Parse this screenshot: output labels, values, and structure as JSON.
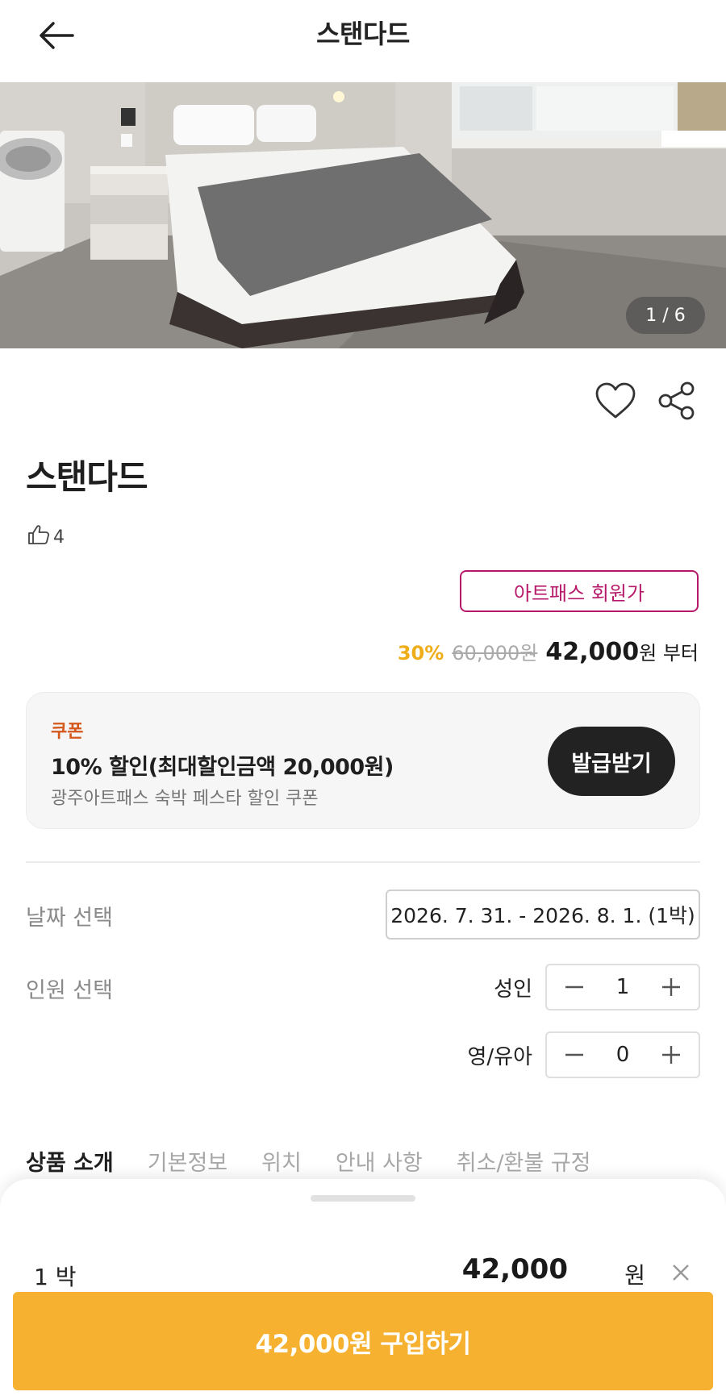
{
  "header": {
    "title": "스탠다드"
  },
  "gallery": {
    "counter": "1 / 6"
  },
  "room": {
    "title": "스탠다드",
    "likes": "4"
  },
  "pricing": {
    "member_badge": "아트패스 회원가",
    "discount": "30%",
    "original": "60,000원",
    "final": "42,000",
    "suffix": "원 부터"
  },
  "coupon": {
    "label": "쿠폰",
    "title": "10% 할인(최대할인금액 20,000원)",
    "description": "광주아트패스 숙박 페스타 할인 쿠폰",
    "button": "발급받기"
  },
  "booking": {
    "date_label": "날짜 선택",
    "date_value": "2026. 7. 31. - 2026. 8. 1. (1박)",
    "guest_label": "인원 선택",
    "adult_label": "성인",
    "adult_count": "1",
    "child_label": "영/유아",
    "child_count": "0"
  },
  "tabs": [
    "상품 소개",
    "기본정보",
    "위치",
    "안내 사항",
    "취소/환불 규정"
  ],
  "sheet": {
    "nights": "1 박",
    "price": "42,000",
    "unit": "원",
    "buy_label": "42,000원 구입하기"
  },
  "colors": {
    "accent": "#f5b12f",
    "badge": "#b7196a",
    "discount": "#f0ad1a",
    "coupon_label": "#d4571b"
  }
}
